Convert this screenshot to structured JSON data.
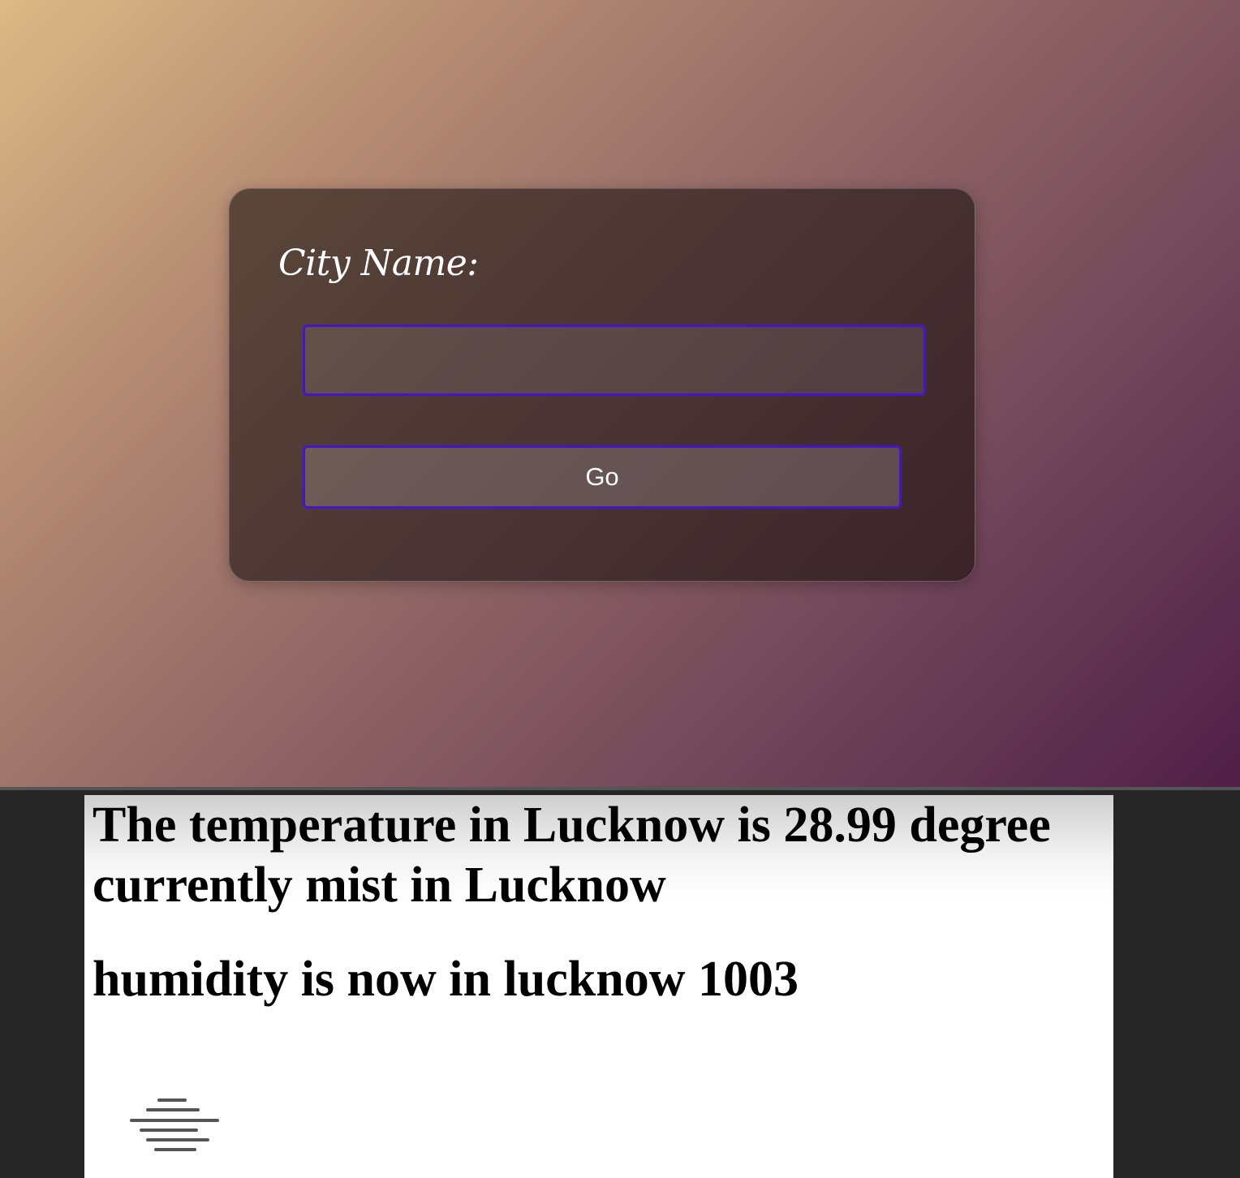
{
  "form": {
    "label": "City Name:",
    "input_value": "",
    "input_placeholder": "",
    "button_label": "Go"
  },
  "result": {
    "temperature_text": "The temperature in Lucknow is 28.99 degree currently mist in Lucknow",
    "humidity_text": "humidity is now in lucknow 1003",
    "weather_icon": "mist-icon"
  },
  "colors": {
    "accent_border": "#4516c8",
    "background_gradient": [
      "#dcb986",
      "#4f1f47"
    ]
  }
}
